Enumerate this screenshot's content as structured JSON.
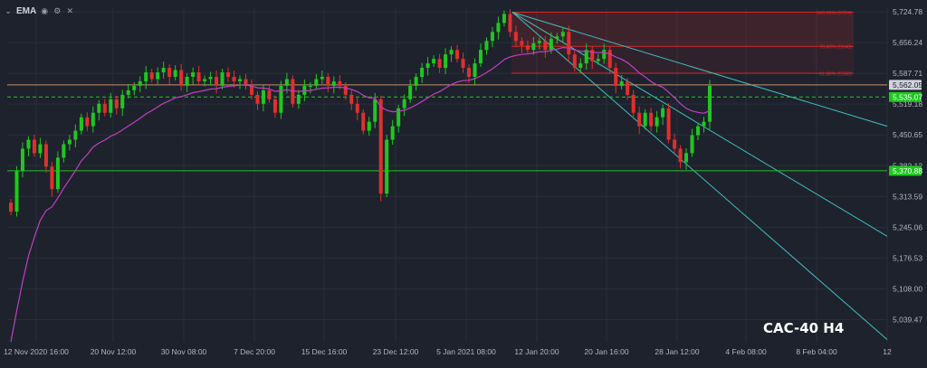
{
  "toolbar": {
    "indicator_label": "EMA",
    "icons": [
      "caret-icon",
      "eye-icon",
      "settings-icon",
      "close-icon"
    ]
  },
  "watermark": "CAC-40 H4",
  "colors": {
    "background": "#1e222d",
    "up": "#1ec81e",
    "down": "#e0302c",
    "ema": "#c040c0",
    "trend": "#3fbfbf",
    "fib": "#d42828",
    "support": "#22c022",
    "resistance": "#c8906a",
    "grid": "#2a2e39",
    "axis_text": "#b2b5be"
  },
  "chart_data": {
    "type": "candlestick",
    "symbol": "CAC-40 H4",
    "ylim": [
      4990,
      5735
    ],
    "y_ticks": [
      5724.78,
      5656.24,
      5587.71,
      5519.18,
      5450.65,
      5382.12,
      5313.59,
      5245.06,
      5176.53,
      5108.0,
      5039.47
    ],
    "x_ticks": [
      "12 Nov 2020 16:00",
      "20 Nov 12:00",
      "30 Nov 08:00",
      "7 Dec 20:00",
      "15 Dec 16:00",
      "23 Dec 12:00",
      "5 Jan 2021 08:00",
      "12 Jan 20:00",
      "20 Jan 16:00",
      "28 Jan 12:00",
      "4 Feb 08:00",
      "8 Feb 04:00",
      "12"
    ],
    "price_labels": [
      {
        "value": "5,562.05",
        "kind": "resistance"
      },
      {
        "value": "5,535.07",
        "kind": "current"
      },
      {
        "value": "5,370.88",
        "kind": "support"
      }
    ],
    "fib_labels": [
      "100.00% (5724)",
      "78.40% (5648)",
      "61.80% (5588)"
    ],
    "candles_close": [
      5280,
      5370,
      5420,
      5440,
      5410,
      5430,
      5380,
      5330,
      5400,
      5430,
      5440,
      5460,
      5490,
      5470,
      5500,
      5520,
      5500,
      5530,
      5510,
      5540,
      5550,
      5560,
      5570,
      5590,
      5575,
      5590,
      5600,
      5580,
      5595,
      5560,
      5580,
      5590,
      5570,
      5575,
      5580,
      5560,
      5590,
      5580,
      5570,
      5575,
      5560,
      5540,
      5520,
      5550,
      5530,
      5500,
      5560,
      5575,
      5520,
      5540,
      5560,
      5560,
      5575,
      5580,
      5560,
      5570,
      5560,
      5540,
      5520,
      5500,
      5460,
      5480,
      5530,
      5320,
      5440,
      5470,
      5510,
      5530,
      5560,
      5580,
      5600,
      5610,
      5620,
      5600,
      5630,
      5640,
      5620,
      5600,
      5580,
      5610,
      5640,
      5660,
      5680,
      5700,
      5720,
      5680,
      5660,
      5650,
      5640,
      5655,
      5660,
      5640,
      5665,
      5670,
      5680,
      5630,
      5600,
      5610,
      5640,
      5615,
      5620,
      5640,
      5600,
      5560,
      5570,
      5540,
      5500,
      5470,
      5500,
      5470,
      5490,
      5510,
      5440,
      5420,
      5390,
      5410,
      5450,
      5470,
      5480,
      5560
    ]
  }
}
